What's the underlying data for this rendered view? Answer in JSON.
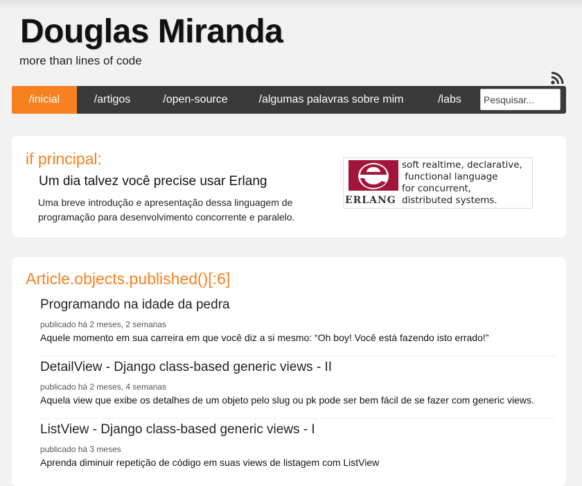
{
  "site": {
    "title": "Douglas Miranda",
    "tagline": "more than lines of code"
  },
  "header": {
    "rss_icon": "rss-icon"
  },
  "nav": {
    "items": [
      {
        "label": "/inicial",
        "active": true
      },
      {
        "label": "/artigos",
        "active": false
      },
      {
        "label": "/open-source",
        "active": false
      },
      {
        "label": "/algumas palavras sobre mim",
        "active": false
      },
      {
        "label": "/labs",
        "active": false
      }
    ],
    "search_placeholder": "Pesquisar..."
  },
  "featured": {
    "heading": "if principal:",
    "title": "Um dia talvez você precise usar Erlang",
    "description": "Uma breve introdução e apresentação dessa linguagem de programação para desenvolvimento concorrente e paralelo.",
    "image": {
      "logo_letter": "e",
      "logo_word": "ERLANG",
      "caption_lines": [
        "soft realtime, declarative,",
        " functional language",
        "for concurrent,",
        "distributed systems."
      ]
    }
  },
  "articles_section": {
    "heading": "Article.objects.published()[:6]",
    "items": [
      {
        "title": "Programando na idade da pedra",
        "date": "publicado há 2 meses, 2 semanas",
        "summary": "Aquele momento em sua carreira em que você diz a si mesmo: “Oh boy! Você está fazendo isto errado!”"
      },
      {
        "title": "DetailView - Django class-based generic views - II",
        "date": "publicado há 2 meses, 4 semanas",
        "summary": "Aquela view que exibe os detalhes de um objeto pelo slug ou pk pode ser bem fácil de se fazer com generic views."
      },
      {
        "title": "ListView - Django class-based generic views - I",
        "date": "publicado há 3 meses",
        "summary": "Aprenda diminuir repetição de código em suas views de listagem com ListView"
      }
    ]
  },
  "colors": {
    "accent": "#f7811f",
    "nav_background": "#3a3a3a",
    "erlang_red": "#a2153b"
  }
}
